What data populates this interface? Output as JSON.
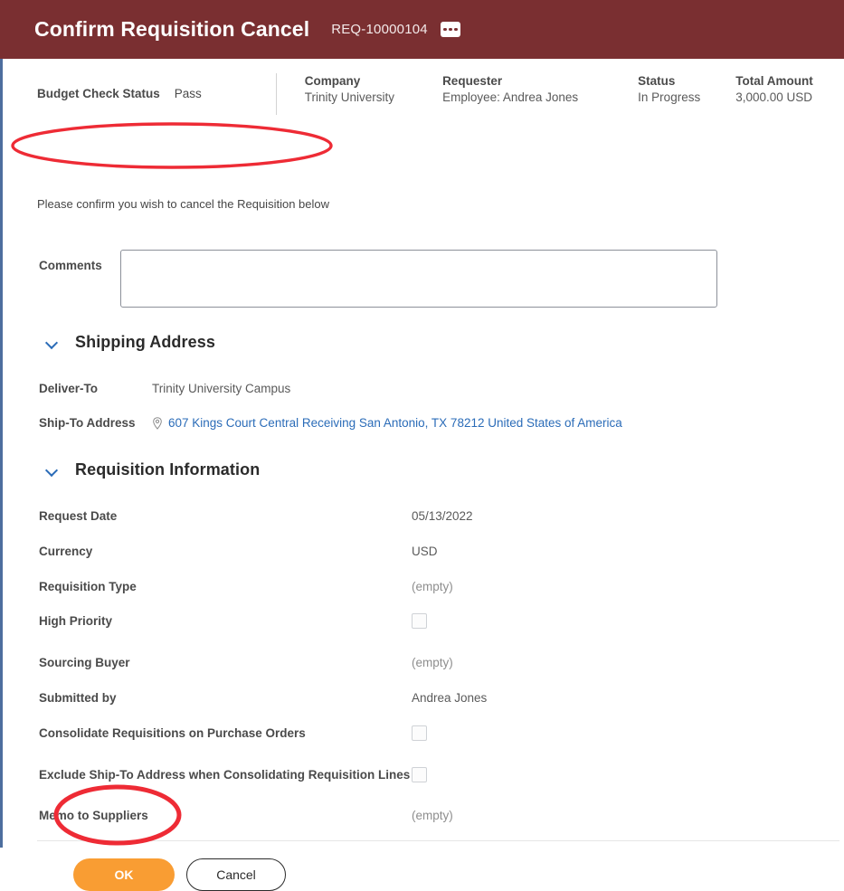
{
  "window": {
    "title": "Confirm Requisition Cancel",
    "reference": "REQ-10000104",
    "related_actions_icon": "ellipsis-icon",
    "header_color": "#7a2f31",
    "accent_color": "#4d6e9e"
  },
  "summary": {
    "budget_check": {
      "label": "Budget Check Status",
      "value": "Pass"
    },
    "items": [
      {
        "label": "Company",
        "value": "Trinity University"
      },
      {
        "label": "Requester",
        "value": "Employee: Andrea Jones"
      },
      {
        "label": "Status",
        "value": "In Progress"
      },
      {
        "label": "Total Amount",
        "value": "3,000.00 USD"
      }
    ]
  },
  "confirm_message": "Please confirm you wish to cancel the Requisition below",
  "comments": {
    "label": "Comments",
    "value": "",
    "placeholder": ""
  },
  "shipping_section": {
    "title": "Shipping Address",
    "chevron_icon": "chevron-down-icon",
    "rows": [
      {
        "label": "Deliver-To",
        "value": "Trinity University Campus",
        "type": "text"
      },
      {
        "label": "Ship-To Address",
        "value": "607 Kings Court Central Receiving San Antonio, TX 78212 United States of America",
        "type": "link",
        "icon": "location-pin-icon"
      }
    ]
  },
  "requisition_section": {
    "title": "Requisition Information",
    "chevron_icon": "chevron-down-icon",
    "rows": [
      {
        "label": "Request Date",
        "value": "05/13/2022",
        "type": "text"
      },
      {
        "label": "Currency",
        "value": "USD",
        "type": "text"
      },
      {
        "label": "Requisition Type",
        "value": "(empty)",
        "type": "empty"
      },
      {
        "label": "High Priority",
        "value": "",
        "type": "checkbox",
        "checked": false
      },
      {
        "label": "Sourcing Buyer",
        "value": "(empty)",
        "type": "empty"
      },
      {
        "label": "Submitted by",
        "value": "Andrea Jones",
        "type": "text"
      },
      {
        "label": "Consolidate Requisitions on Purchase Orders",
        "value": "",
        "type": "checkbox",
        "checked": false
      },
      {
        "label": "Exclude Ship-To Address when Consolidating Requisition Lines",
        "value": "",
        "type": "checkbox",
        "checked": false
      },
      {
        "label": "Memo to Suppliers",
        "value": "(empty)",
        "type": "empty"
      }
    ]
  },
  "footer": {
    "ok_label": "OK",
    "cancel_label": "Cancel",
    "ok_color": "#f99d33"
  },
  "annotations": {
    "color": "#ee2b35",
    "shapes": [
      {
        "name": "highlight-confirm-message",
        "shape": "ellipse"
      },
      {
        "name": "highlight-ok-button",
        "shape": "ellipse"
      }
    ]
  }
}
